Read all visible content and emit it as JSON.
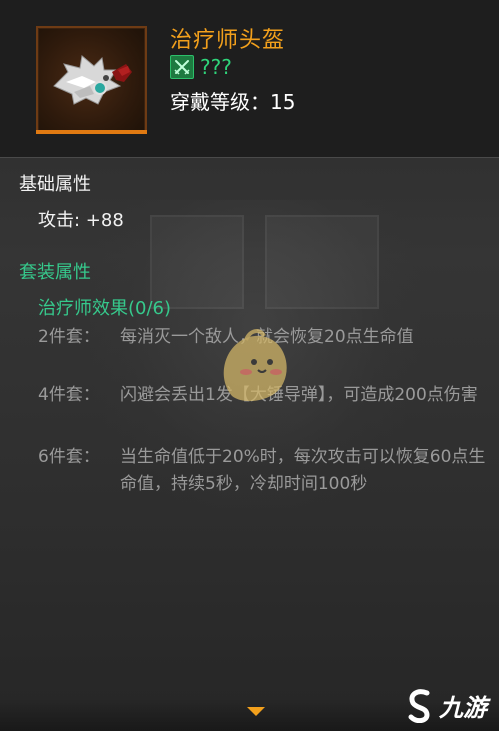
{
  "item": {
    "name": "治疗师头盔",
    "rarity": "???",
    "wear_level": "穿戴等级：15"
  },
  "base_attributes": {
    "title": "基础属性",
    "stats": [
      {
        "text": "攻击: +88"
      }
    ]
  },
  "set_attributes": {
    "title": "套装属性",
    "set_name": "治疗师效果(0/6)",
    "bonuses": [
      {
        "label": "2件套：",
        "text": "每消灭一个敌人，就会恢复20点生命值"
      },
      {
        "label": "4件套：",
        "text": "闪避会丢出1发【大锤导弹】，可造成200点伤害"
      },
      {
        "label": "6件套：",
        "text": "当生命值低于20%时，每次攻击可以恢复60点生命值，持续5秒，冷却时间100秒"
      }
    ]
  },
  "watermark": {
    "brand": "九游"
  },
  "colors": {
    "item_name": "#f2a01c",
    "rarity": "#2fd47a",
    "set_title": "#36c98c",
    "bonus_text": "#9a9a9a",
    "frame_accent": "#e07a12"
  },
  "icons": {
    "rarity": "crossed-swords-icon",
    "item": "helmet-icon",
    "footer": "chevron-down-icon",
    "brand": "jiuyou-logo-icon"
  }
}
